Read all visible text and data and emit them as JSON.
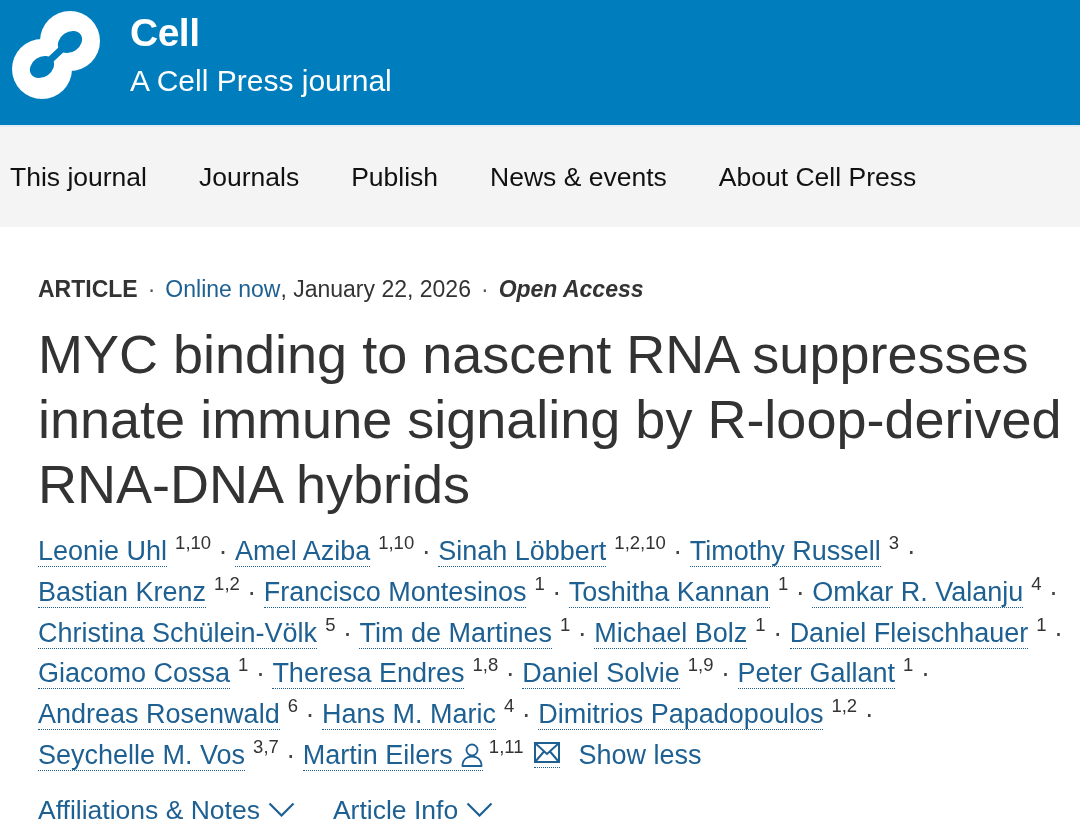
{
  "header": {
    "title": "Cell",
    "subtitle": "A Cell Press journal"
  },
  "nav": [
    "This journal",
    "Journals",
    "Publish",
    "News & events",
    "About Cell Press"
  ],
  "article": {
    "meta": {
      "type": "ARTICLE",
      "separator": "·",
      "status_link": "Online now",
      "date": ", January 22, 2026",
      "access": "Open Access"
    },
    "title": "MYC binding to nascent RNA suppresses innate immune signaling by R-loop-derived RNA-DNA hybrids",
    "authors": {
      "separator": "·",
      "list": [
        {
          "name": "Leonie Uhl",
          "affiliations": "1,10",
          "corresponding": false,
          "email_link": false
        },
        {
          "name": "Amel Aziba",
          "affiliations": "1,10",
          "corresponding": false,
          "email_link": false
        },
        {
          "name": "Sinah Löbbert",
          "affiliations": "1,2,10",
          "corresponding": false,
          "email_link": false
        },
        {
          "name": "Timothy Russell",
          "affiliations": "3",
          "corresponding": false,
          "email_link": false
        },
        {
          "name": "Bastian Krenz",
          "affiliations": "1,2",
          "corresponding": false,
          "email_link": false
        },
        {
          "name": "Francisco Montesinos",
          "affiliations": "1",
          "corresponding": false,
          "email_link": false
        },
        {
          "name": "Toshitha Kannan",
          "affiliations": "1",
          "corresponding": false,
          "email_link": false
        },
        {
          "name": "Omkar R. Valanju",
          "affiliations": "4",
          "corresponding": false,
          "email_link": false
        },
        {
          "name": "Christina Schülein-Völk",
          "affiliations": "5",
          "corresponding": false,
          "email_link": false
        },
        {
          "name": "Tim de Martines",
          "affiliations": "1",
          "corresponding": false,
          "email_link": false
        },
        {
          "name": "Michael Bolz",
          "affiliations": "1",
          "corresponding": false,
          "email_link": false
        },
        {
          "name": "Daniel Fleischhauer",
          "affiliations": "1",
          "corresponding": false,
          "email_link": false
        },
        {
          "name": "Giacomo Cossa",
          "affiliations": "1",
          "corresponding": false,
          "email_link": false
        },
        {
          "name": "Theresa Endres",
          "affiliations": "1,8",
          "corresponding": false,
          "email_link": false
        },
        {
          "name": "Daniel Solvie",
          "affiliations": "1,9",
          "corresponding": false,
          "email_link": false
        },
        {
          "name": "Peter Gallant",
          "affiliations": "1",
          "corresponding": false,
          "email_link": false
        },
        {
          "name": "Andreas Rosenwald",
          "affiliations": "6",
          "corresponding": false,
          "email_link": false
        },
        {
          "name": "Hans M. Maric",
          "affiliations": "4",
          "corresponding": false,
          "email_link": false
        },
        {
          "name": "Dimitrios Papadopoulos",
          "affiliations": "1,2",
          "corresponding": false,
          "email_link": false
        },
        {
          "name": "Seychelle M. Vos",
          "affiliations": "3,7",
          "corresponding": false,
          "email_link": false
        },
        {
          "name": "Martin Eilers",
          "affiliations": "1,11",
          "corresponding": true,
          "email_link": true
        }
      ],
      "toggle": "Show less"
    },
    "sections": [
      {
        "label": "Affiliations & Notes",
        "expanded": false
      },
      {
        "label": "Article Info",
        "expanded": false
      }
    ]
  }
}
